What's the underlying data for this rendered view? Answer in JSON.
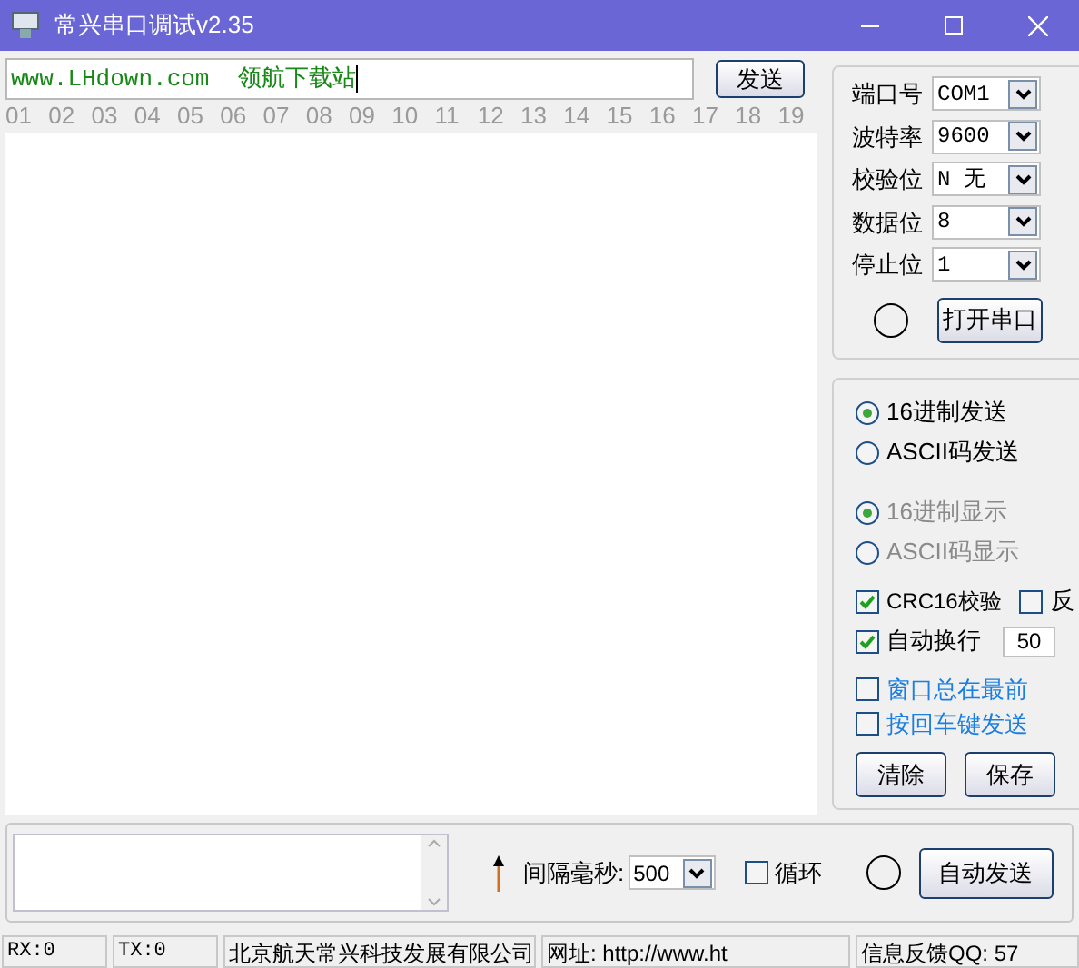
{
  "window": {
    "title": "常兴串口调试v2.35"
  },
  "send_field": {
    "value": "www.LHdown.com  领航下载站"
  },
  "send_button": "发送",
  "column_numbers": [
    "01",
    "02",
    "03",
    "04",
    "05",
    "06",
    "07",
    "08",
    "09",
    "10",
    "11",
    "12",
    "13",
    "14",
    "15",
    "16",
    "17",
    "18",
    "19"
  ],
  "port_settings": [
    {
      "label": "端口号",
      "value": "COM1"
    },
    {
      "label": "波特率",
      "value": "9600"
    },
    {
      "label": "校验位",
      "value": "N 无"
    },
    {
      "label": "数据位",
      "value": "8"
    },
    {
      "label": "停止位",
      "value": "1"
    }
  ],
  "open_port_button": "打开串口",
  "send_modes": [
    {
      "label": "16进制发送",
      "selected": true,
      "disabled": false
    },
    {
      "label": "ASCII码发送",
      "selected": false,
      "disabled": false
    }
  ],
  "display_modes": [
    {
      "label": "16进制显示",
      "selected": true,
      "disabled": true
    },
    {
      "label": "ASCII码显示",
      "selected": false,
      "disabled": true
    }
  ],
  "crc": {
    "label": "CRC16校验",
    "checked": true
  },
  "reverse": {
    "label": "反",
    "checked": false
  },
  "auto_wrap": {
    "label": "自动换行",
    "checked": true,
    "value": "50"
  },
  "options": [
    {
      "label": "窗口总在最前",
      "checked": false
    },
    {
      "label": "按回车键发送",
      "checked": false
    }
  ],
  "action_buttons": [
    "清除",
    "保存"
  ],
  "interval": {
    "label": "间隔毫秒:",
    "value": "500"
  },
  "loop": {
    "label": "循环",
    "checked": false
  },
  "auto_send_button": "自动发送",
  "status_bar": [
    "RX:0",
    "TX:0",
    "北京航天常兴科技发展有限公司",
    "网址: http://www.ht",
    "信息反馈QQ: 57"
  ]
}
